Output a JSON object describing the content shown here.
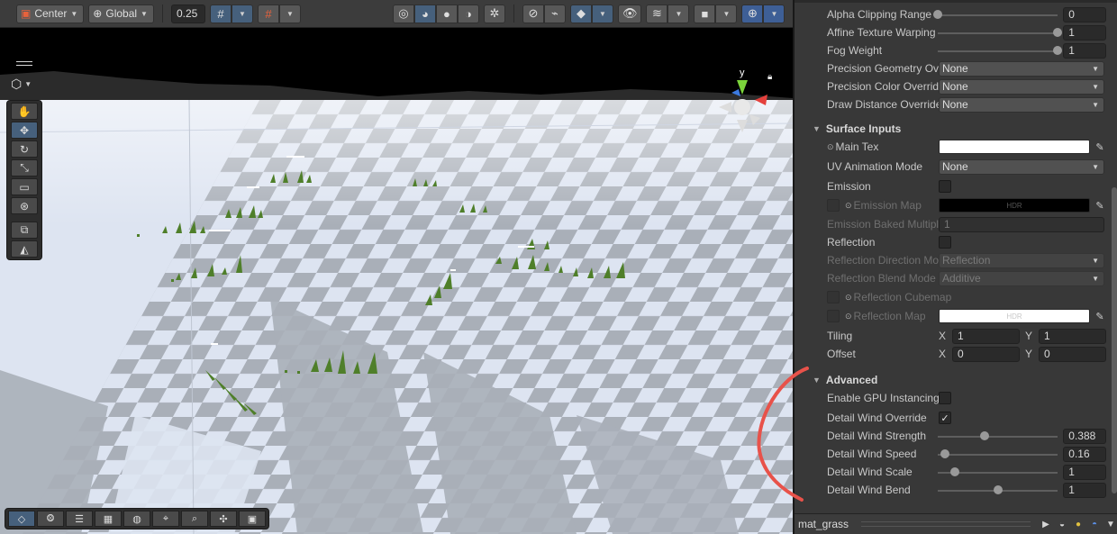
{
  "toolbar": {
    "pivot_mode": "Center",
    "pivot_rotation": "Global",
    "snap_increment": "0.25"
  },
  "scene": {
    "gizmo_axis_label": "y"
  },
  "inspector": {
    "rows": {
      "alpha_clipping_range": {
        "label": "Alpha Clipping Range",
        "value": "0",
        "level": 0
      },
      "affine_texture_warping": {
        "label": "Affine Texture Warping",
        "value": "1",
        "level": 1
      },
      "fog_weight": {
        "label": "Fog Weight",
        "value": "1",
        "level": 1
      },
      "precision_geometry": {
        "label": "Precision Geometry Override",
        "value": "None"
      },
      "precision_color": {
        "label": "Precision Color Override",
        "value": "None"
      },
      "draw_distance": {
        "label": "Draw Distance Override",
        "value": "None"
      }
    },
    "surface_inputs": {
      "header": "Surface Inputs",
      "main_tex": {
        "label": "Main Tex",
        "color": "#ffffff"
      },
      "uv_animation_mode": {
        "label": "UV Animation Mode",
        "value": "None"
      },
      "emission": {
        "label": "Emission",
        "checked": false
      },
      "emission_map": {
        "label": "Emission Map",
        "swatch_text": "HDR",
        "color": "#000000"
      },
      "emission_baked_multiplier": {
        "label": "Emission Baked Multiplier",
        "value": "1"
      },
      "reflection": {
        "label": "Reflection",
        "checked": false
      },
      "reflection_direction_mode": {
        "label": "Reflection Direction Mode",
        "value": "Reflection"
      },
      "reflection_blend_mode": {
        "label": "Reflection Blend Mode",
        "value": "Additive"
      },
      "reflection_cubemap": {
        "label": "Reflection Cubemap"
      },
      "reflection_map": {
        "label": "Reflection Map",
        "swatch_text": "HDR",
        "color": "#ffffff"
      },
      "tiling": {
        "label": "Tiling",
        "x": "1",
        "y": "1"
      },
      "offset": {
        "label": "Offset",
        "x": "0",
        "y": "0"
      },
      "axis_x": "X",
      "axis_y": "Y"
    },
    "advanced": {
      "header": "Advanced",
      "enable_gpu_instancing": {
        "label": "Enable GPU Instancing",
        "checked": false
      },
      "detail_wind_override": {
        "label": "Detail Wind Override",
        "checked": true,
        "check_glyph": "✓"
      },
      "detail_wind_strength": {
        "label": "Detail Wind Strength",
        "value": "0.388",
        "level": 0.388
      },
      "detail_wind_speed": {
        "label": "Detail Wind Speed",
        "value": "0.16",
        "level": 0.06
      },
      "detail_wind_scale": {
        "label": "Detail Wind Scale",
        "value": "1",
        "level": 0.14
      },
      "detail_wind_bend": {
        "label": "Detail Wind Bend",
        "value": "1",
        "level": 0.5
      }
    },
    "footer": {
      "title": "mat_grass"
    }
  },
  "colors": {
    "annotation": "#e8524a",
    "grass": "#4f7f2a",
    "floor_light": "#dde4f1",
    "floor_dark": "#a9afb8",
    "active_tool": "#46607c"
  },
  "icons": {
    "toolbar": [
      "center-pivot-icon",
      "global-icon",
      "grid-snap-icon",
      "grid-icon",
      "wireframe-icon",
      "shaded-icon",
      "unlit-icon",
      "lighting-icon",
      "debug-icon",
      "2d-icon",
      "audio-icon",
      "effects-icon",
      "visibility-icon",
      "layers-icon",
      "camera-icon",
      "gizmos-icon"
    ],
    "tools": [
      "hand-icon",
      "move-icon",
      "rotate-icon",
      "scale-icon",
      "rect-icon",
      "transform-icon",
      "custom-tool-icon",
      "terrain-icon"
    ]
  }
}
